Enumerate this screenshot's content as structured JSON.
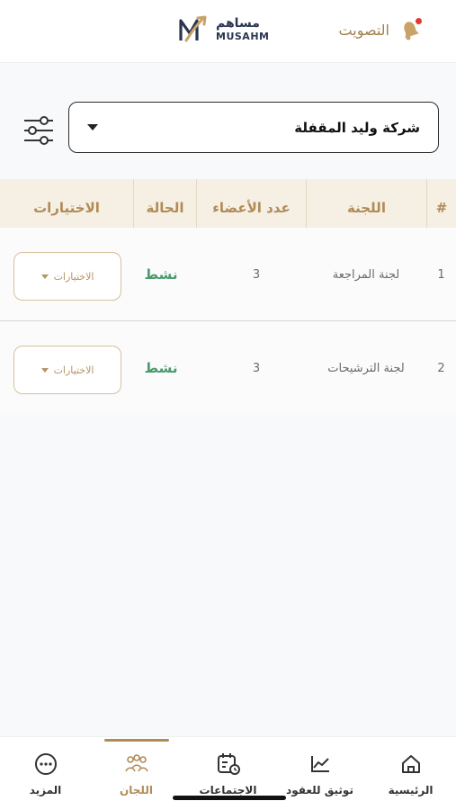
{
  "header": {
    "vote_label": "التصويت",
    "logo_ar": "مساهم",
    "logo_en": "MUSAHM"
  },
  "company_select": {
    "value": "شركة وليد المقفلة"
  },
  "table": {
    "columns": [
      "#",
      "اللجنة",
      "عدد الأعضاء",
      "الحالة",
      "الاختيارات"
    ],
    "rows": [
      {
        "index": "1",
        "committee": "لجنة المراجعة",
        "members": "3",
        "status": "نشط",
        "options": "الاختيارات"
      },
      {
        "index": "2",
        "committee": "لجنة الترشيحات",
        "members": "3",
        "status": "نشط",
        "options": "الاختيارات"
      }
    ]
  },
  "bottom_nav": {
    "items": [
      {
        "label": "الرئيسية",
        "icon": "home-icon"
      },
      {
        "label": "توثيق للعقود",
        "icon": "chart-icon"
      },
      {
        "label": "الاجتماعات",
        "icon": "calendar-icon"
      },
      {
        "label": "اللجان",
        "icon": "committee-icon",
        "active": true
      },
      {
        "label": "المزيد",
        "icon": "more-icon"
      }
    ]
  },
  "colors": {
    "accent": "#b08b55",
    "status_green": "#4a9a6c",
    "header_bg": "#f6efe4"
  }
}
